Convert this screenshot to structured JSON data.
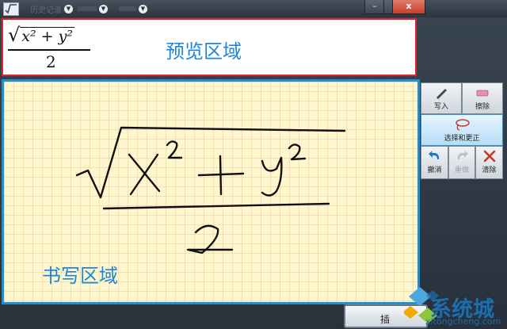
{
  "window": {
    "menus": [
      "历史记录",
      "",
      ""
    ],
    "minimize_glyph": "–",
    "close_glyph": "x"
  },
  "preview": {
    "label": "预览区域",
    "formula_base": "x² + y²",
    "formula_denominator": "2"
  },
  "writing": {
    "label": "书写区域"
  },
  "tools": {
    "write": "写入",
    "erase": "擦除",
    "select_correct": "选择和更正",
    "undo": "撤消",
    "redo": "重做",
    "clear": "清除"
  },
  "insert_button": "插",
  "watermark": {
    "text": "系统城",
    "url": "xitongcheng.com"
  }
}
